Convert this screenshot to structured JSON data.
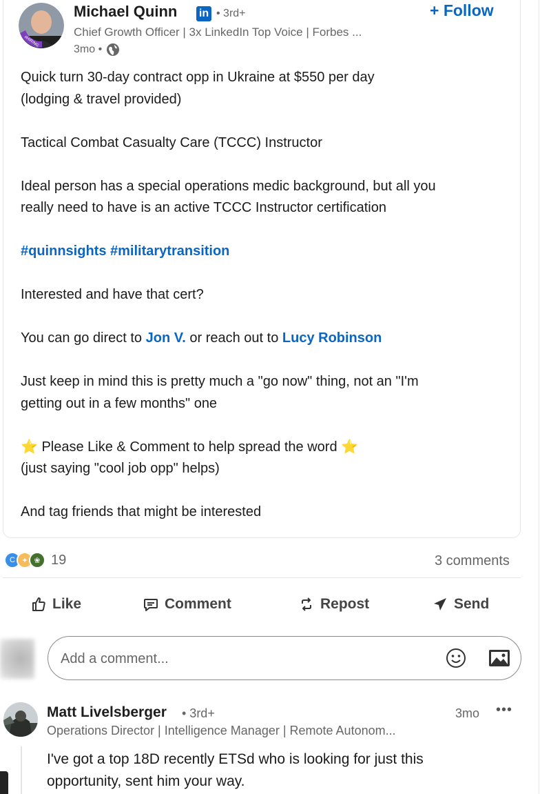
{
  "post": {
    "author": {
      "name": "Michael Quinn",
      "badge": "in",
      "degree": "• 3rd+",
      "headline": "Chief Growth Officer | 3x LinkedIn Top Voice | Forbes ...",
      "time": "3mo •",
      "avatar_frame_text": "#HIRING"
    },
    "follow_label": "+ Follow",
    "body": {
      "line1": "Quick turn 30-day contract opp in Ukraine at $550 per day",
      "line2": "(lodging & travel provided)",
      "line3": "Tactical Combat Casualty Care (TCCC) Instructor",
      "line4": "Ideal person has a special operations medic background, but all you",
      "line5": "really need to have is an active TCCC Instructor certification",
      "hashtag1": "#quinnsights",
      "hashtag2": "#militarytransition",
      "line6": "Interested and have that cert?",
      "line7_pre": "You can go direct to ",
      "mention1": "Jon V.",
      "line7_mid": " or reach out to ",
      "mention2": "Lucy Robinson",
      "line8": "Just keep in mind this is pretty much a \"go now\" thing, not an \"I'm",
      "line9": "getting out in a few months\" one",
      "star": "⭐",
      "line10": " Please Like & Comment to help spread the word ",
      "line11": "(just saying \"cool job opp\" helps)",
      "line12": "And tag friends that might be interested"
    }
  },
  "social": {
    "reaction_count": "19",
    "comments_count": "3 comments"
  },
  "actions": {
    "like": "Like",
    "comment": "Comment",
    "repost": "Repost",
    "send": "Send"
  },
  "comment_input": {
    "placeholder": "Add a comment..."
  },
  "comment": {
    "author": "Matt Livelsberger",
    "degree": "• 3rd+",
    "headline": "Operations Director | Intelligence Manager | Remote Autonom...",
    "time": "3mo",
    "more": "•••",
    "text_line1": "I've got a top 18D recently ETSd who is looking for just this",
    "text_line2": "opportunity, sent him your way."
  },
  "colors": {
    "brand_blue": "#0a66c2",
    "hiring_purple": "#7b3fbf",
    "muted_text": "#666666"
  }
}
